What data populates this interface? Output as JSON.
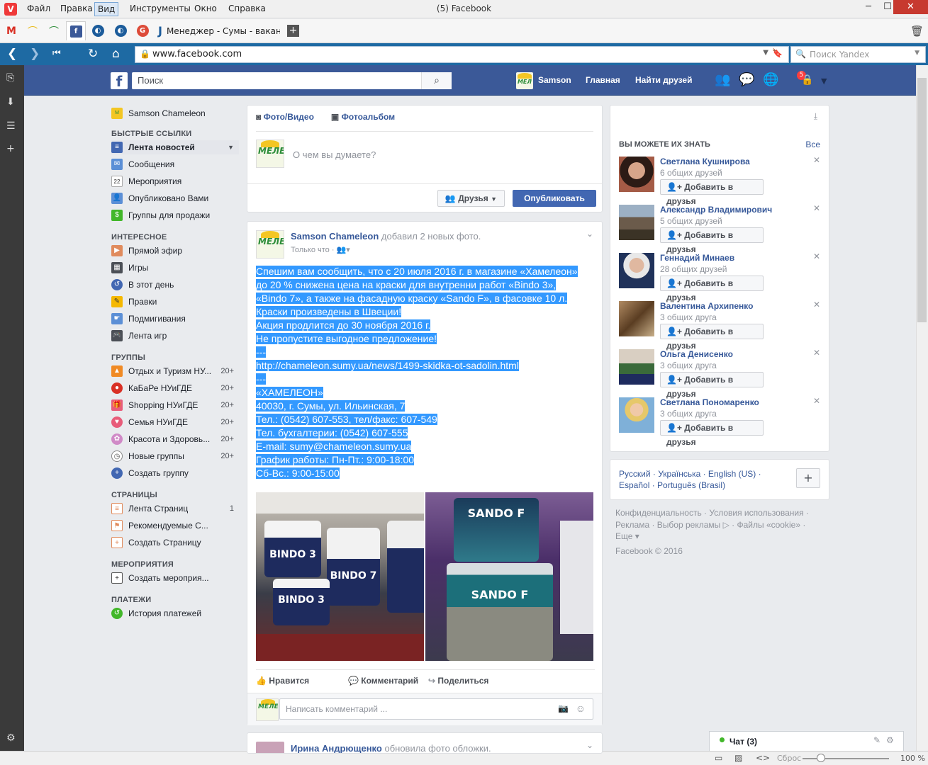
{
  "browser": {
    "window_title": "(5) Facebook",
    "menu": [
      "Файл",
      "Правка",
      "Вид",
      "Инструменты",
      "Окно",
      "Справка"
    ],
    "long_tab_label": "Менеджер - Сумы - ваканс",
    "url": "www.facebook.com",
    "search_placeholder": "Поиск Yandex",
    "status_reset": "Сброс",
    "zoom": "100 %"
  },
  "fb_header": {
    "search_placeholder": "Поиск",
    "user": "Samson",
    "home": "Главная",
    "find_friends": "Найти друзей",
    "notif_count": "5"
  },
  "leftnav": {
    "profile": "Samson Chameleon",
    "quick_links_head": "БЫСТРЫЕ ССЫЛКИ",
    "quick_links": [
      "Лента новостей",
      "Сообщения",
      "Мероприятия",
      "Опубликовано Вами",
      "Группы для продажи"
    ],
    "interesting_head": "ИНТЕРЕСНОЕ",
    "interesting": [
      "Прямой эфир",
      "Игры",
      "В этот день",
      "Правки",
      "Подмигивания",
      "Лента игр"
    ],
    "groups_head": "ГРУППЫ",
    "groups": [
      {
        "label": "Отдых и Туризм НУ...",
        "count": "20+"
      },
      {
        "label": "КаБаРе НУиГДЕ",
        "count": "20+"
      },
      {
        "label": "Shopping НУиГДЕ",
        "count": "20+"
      },
      {
        "label": "Семья НУиГДЕ",
        "count": "20+"
      },
      {
        "label": "Красота и Здоровь...",
        "count": "20+"
      },
      {
        "label": "Новые группы",
        "count": "20+"
      },
      {
        "label": "Создать группу",
        "count": ""
      }
    ],
    "pages_head": "СТРАНИЦЫ",
    "pages": [
      {
        "label": "Лента Страниц",
        "count": "1"
      },
      {
        "label": "Рекомендуемые С...",
        "count": ""
      },
      {
        "label": "Создать Страницу",
        "count": ""
      }
    ],
    "events_head": "МЕРОПРИЯТИЯ",
    "events": [
      "Создать мероприя..."
    ],
    "payments_head": "ПЛАТЕЖИ",
    "payments": [
      "История платежей"
    ]
  },
  "composer": {
    "tab_photo": "Фото/Видео",
    "tab_album": "Фотоальбом",
    "placeholder": "О чем вы думаете?",
    "audience": "Друзья",
    "publish": "Опубликовать"
  },
  "post": {
    "author": "Samson Chameleon",
    "action": "добавил 2 новых фото.",
    "time": "Только что",
    "lines": [
      "Спешим вам сообщить, что с 20 июля 2016 г. в магазине «Хамелеон»",
      "до 20 % снижена цена на краски для внутренни работ «Bindo 3»,",
      "«Bindo 7», а также на фасадную краску «Sando F», в фасовке 10 л.",
      "Краски произведены в Швеции!",
      "Акция продлится до 30 ноября 2016 г.",
      "Не пропустите выгодное предложение!",
      "---",
      "http://chameleon.sumy.ua/news/1499-skidka-ot-sadolin.html",
      "---",
      "«ХАМЕЛЕОН»",
      "40030, г. Сумы, ул. Ильинская, 7",
      "Тел.: (0542) 607-553, тел/факс: 607-549",
      "Тел. бухгалтерии: (0542) 607-555",
      "E-mail: sumy@chameleon.sumy.ua",
      "График работы: Пн-Пт.: 9:00-18:00",
      "Сб-Вс.: 9:00-15:00"
    ],
    "photo1_labels": [
      "BINDO 3",
      "BINDO 7",
      "BINDO 3"
    ],
    "photo2_labels": [
      "SANDO F",
      "SANDO F"
    ],
    "like": "Нравится",
    "comment": "Комментарий",
    "share": "Поделиться",
    "comment_placeholder": "Написать комментарий ..."
  },
  "next_post": {
    "author": "Ирина Андрющенко",
    "action": "обновила фото обложки."
  },
  "pymk": {
    "title": "ВЫ МОЖЕТЕ ИХ ЗНАТЬ",
    "all": "Все",
    "add_label": "Добавить в друзья",
    "people": [
      {
        "name": "Светлана Кушнирова",
        "mutual": "6 общих друзей"
      },
      {
        "name": "Александр Владимирович",
        "mutual": "5 общих друзей"
      },
      {
        "name": "Геннадий Минаев",
        "mutual": "28 общих друзей"
      },
      {
        "name": "Валентина Архипенко",
        "mutual": "3 общих друга"
      },
      {
        "name": "Ольга Денисенко",
        "mutual": "3 общих друга"
      },
      {
        "name": "Светлана Пономаренко",
        "mutual": "3 общих друга"
      }
    ]
  },
  "langs": {
    "line1": "Русский · Українська · English (US) ·",
    "line2": "Español · Português (Brasil)"
  },
  "footer": {
    "line1": "Конфиденциальность · Условия использования ·",
    "line2": "Реклама · Выбор рекламы ▷ · Файлы «cookie» ·",
    "line3": "Еще ▾",
    "line4": "Facebook © 2016"
  },
  "chat": {
    "label": "Чат (3)"
  }
}
